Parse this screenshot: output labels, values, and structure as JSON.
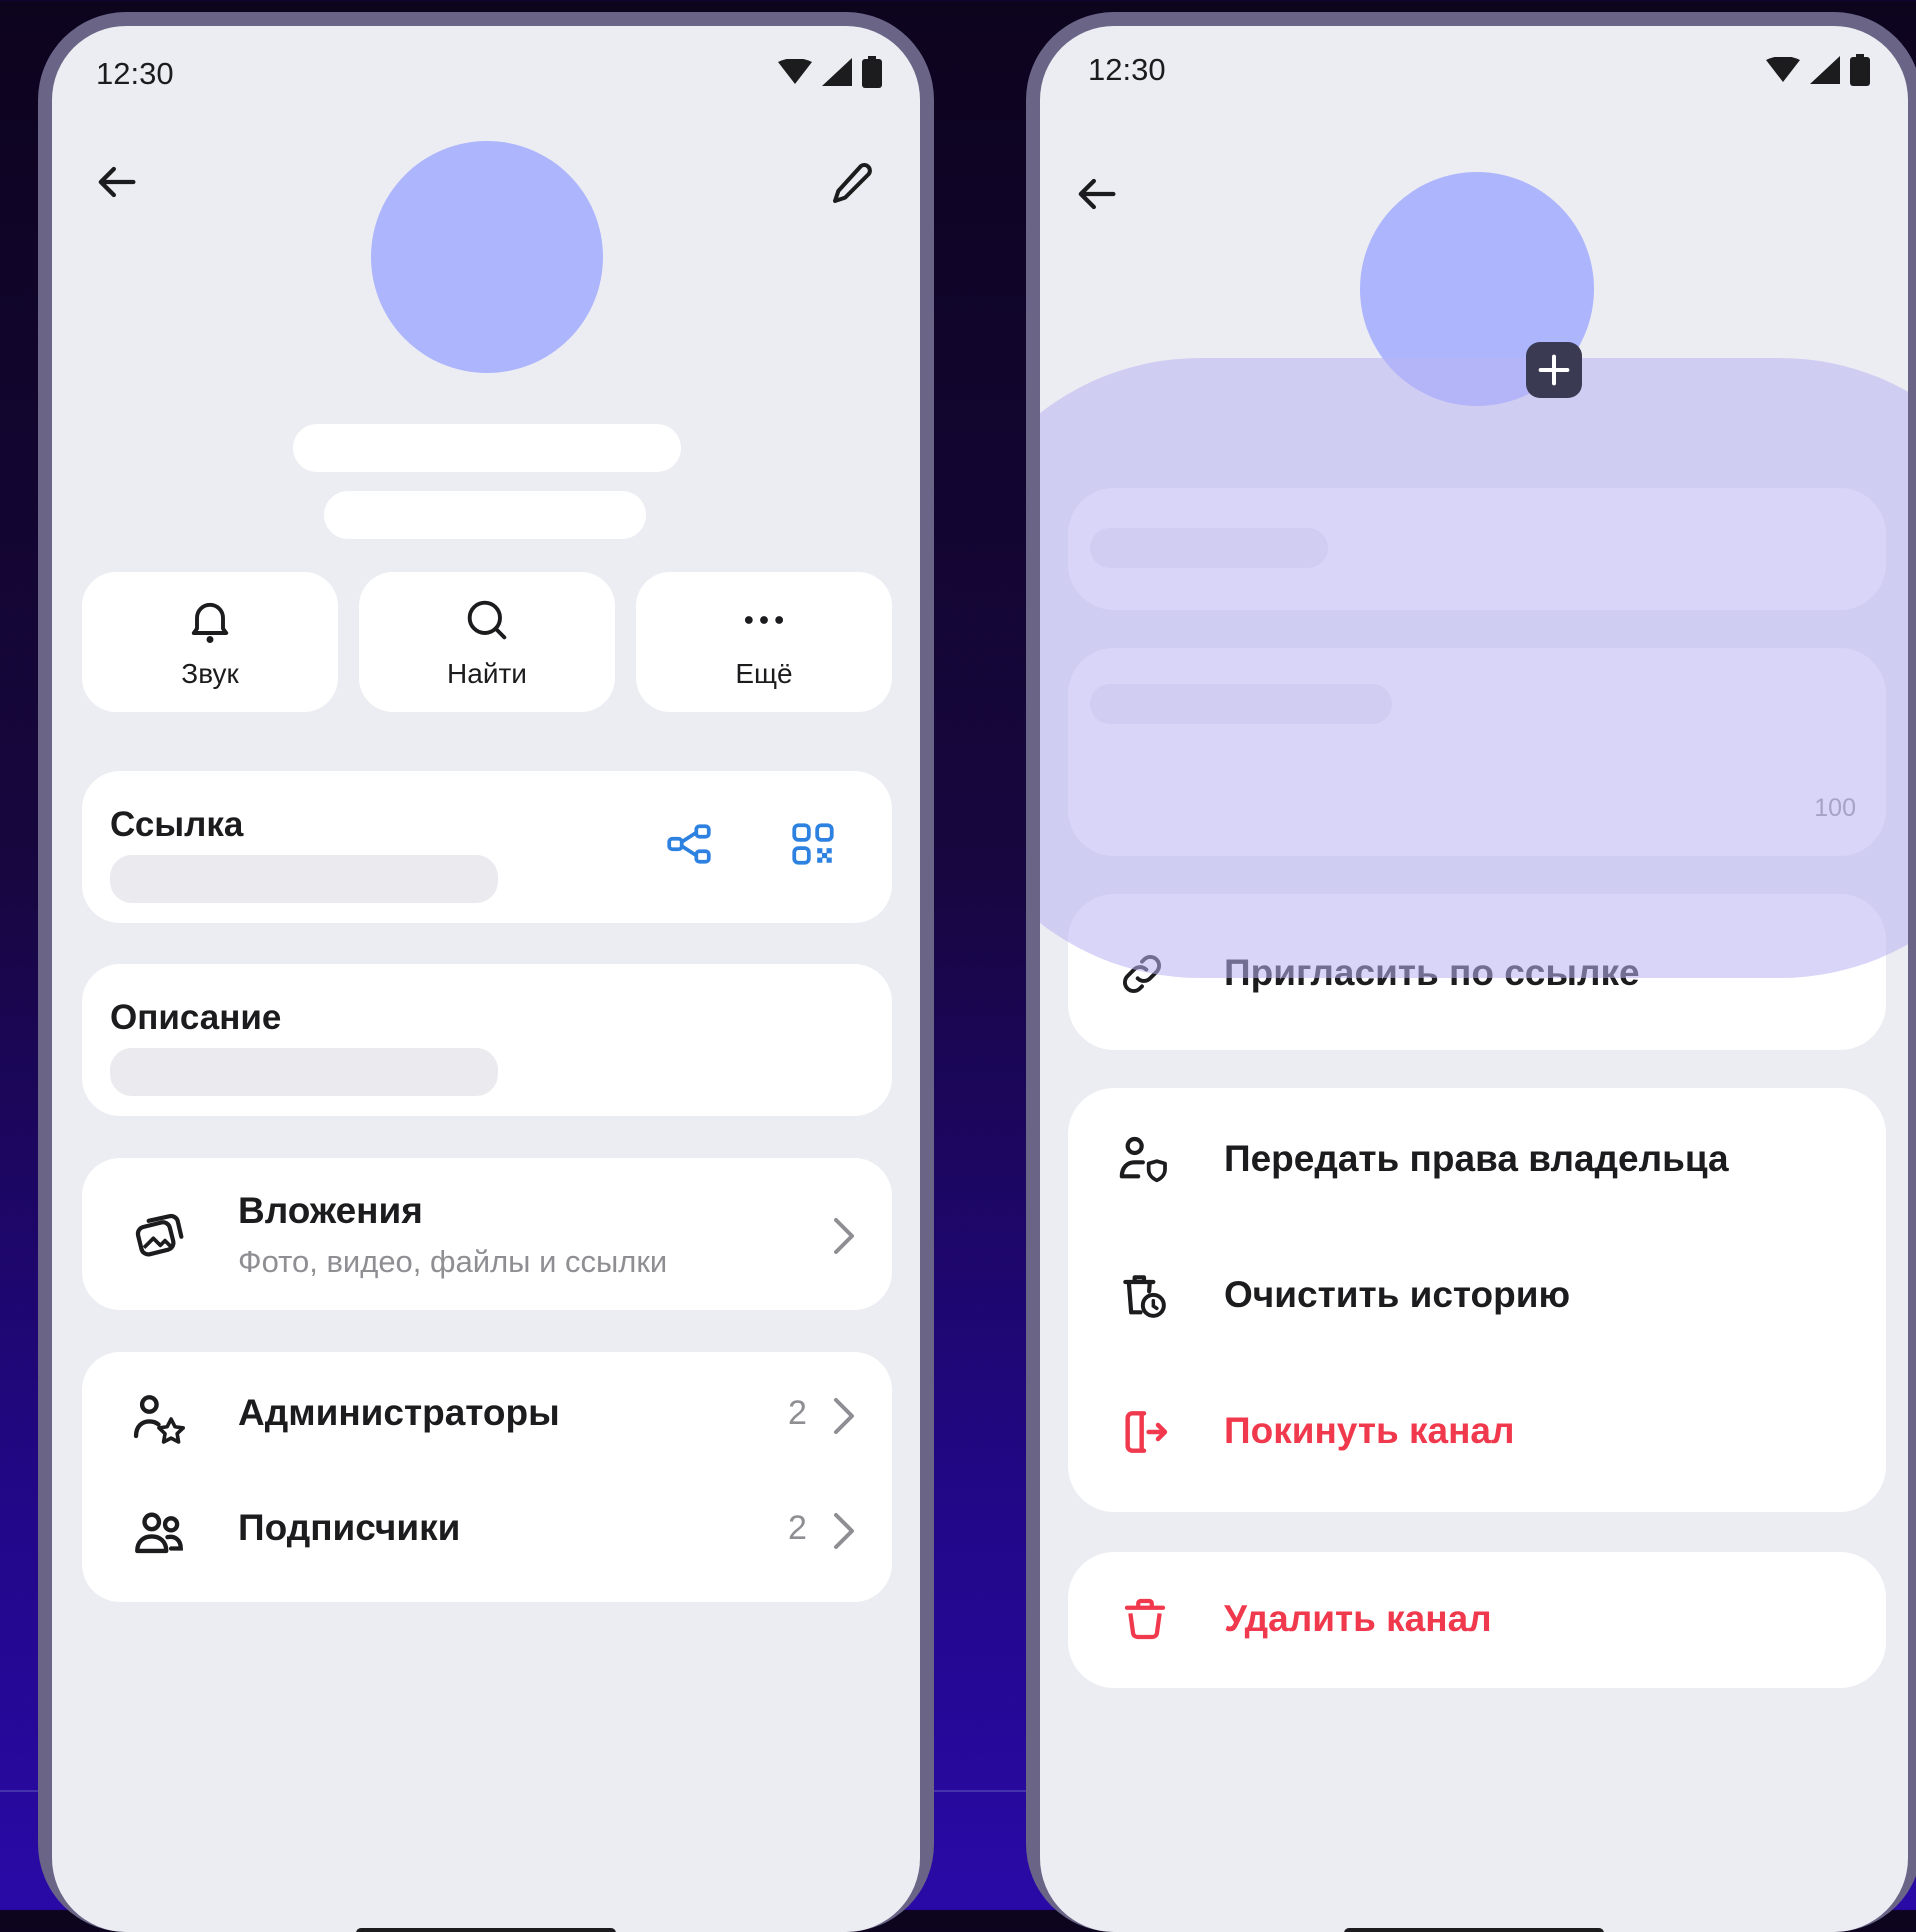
{
  "status": {
    "time": "12:30"
  },
  "left": {
    "actions": [
      {
        "label": "Звук",
        "icon": "bell-icon"
      },
      {
        "label": "Найти",
        "icon": "search-icon"
      },
      {
        "label": "Ещё",
        "icon": "more-icon"
      }
    ],
    "link_card": {
      "title": "Ссылка"
    },
    "description_card": {
      "title": "Описание"
    },
    "attachments": {
      "title": "Вложения",
      "subtitle": "Фото, видео, файлы и ссылки"
    },
    "members": [
      {
        "label": "Администраторы",
        "count": "2"
      },
      {
        "label": "Подписчики",
        "count": "2"
      }
    ]
  },
  "right": {
    "description_counter": "100",
    "invite_label": "Пригласить по ссылке",
    "actions": [
      {
        "label": "Передать права владельца"
      },
      {
        "label": "Очистить историю"
      },
      {
        "label": "Покинуть канал"
      }
    ],
    "delete_label": "Удалить канал"
  },
  "colors": {
    "accent": "#2d81e0",
    "danger": "#f0394c",
    "avatar": "#adb5fd",
    "highlight": "#c9c4f5"
  }
}
